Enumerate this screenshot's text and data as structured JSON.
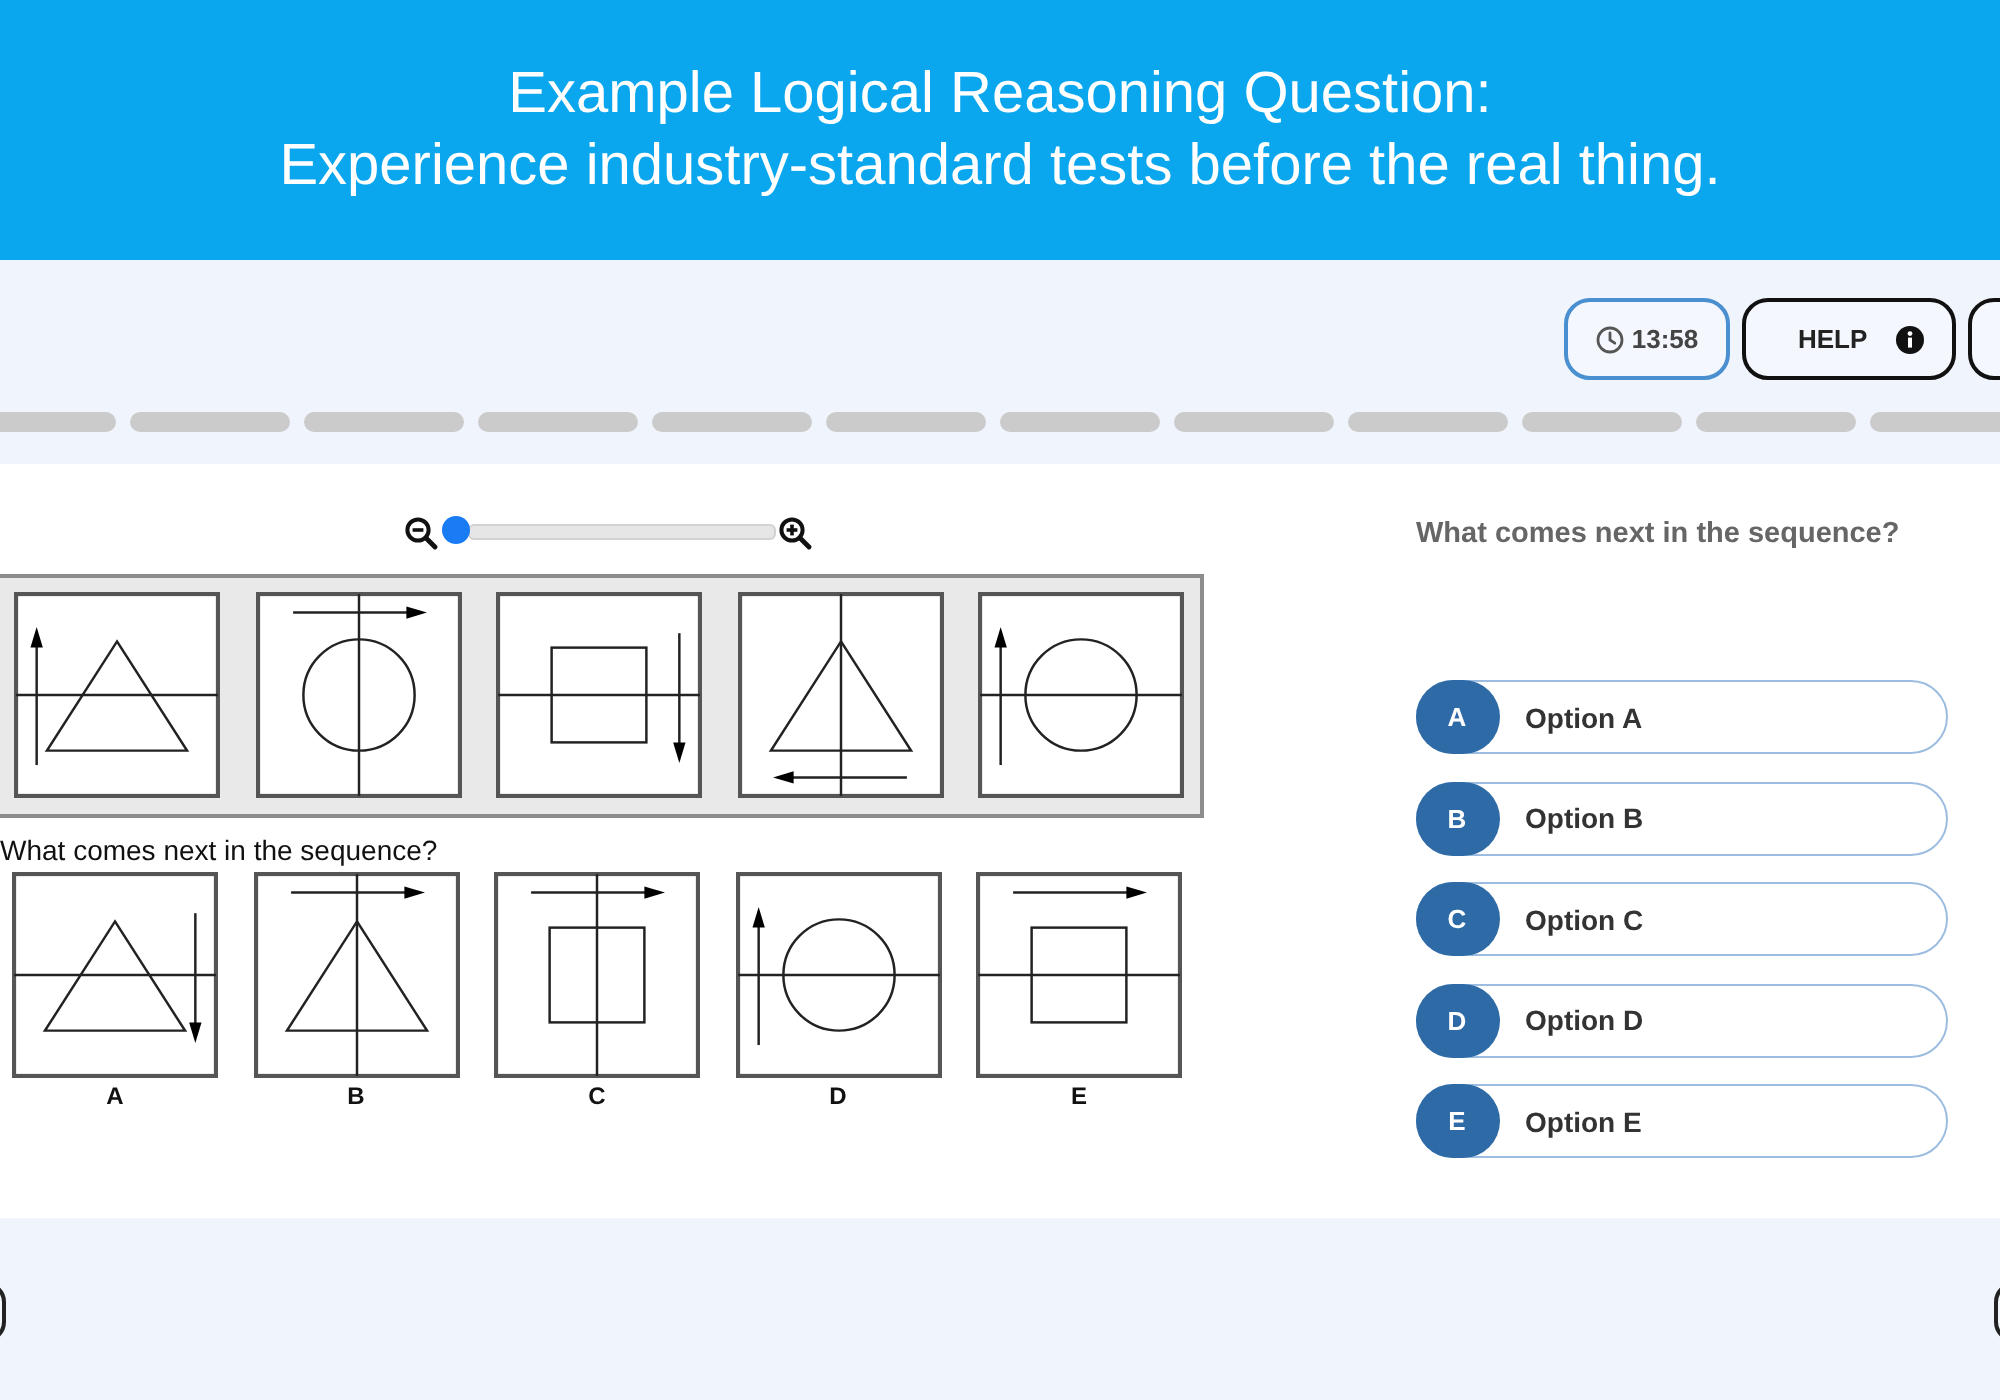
{
  "banner": {
    "title": "Example Logical Reasoning Question:",
    "subtitle": "Experience industry-standard tests before the real thing."
  },
  "toolbar": {
    "timer": "13:58",
    "help": "HELP"
  },
  "progress": {
    "segments": [
      {
        "completed": false
      },
      {
        "completed": false
      },
      {
        "completed": false
      },
      {
        "completed": false
      },
      {
        "completed": false
      },
      {
        "completed": false
      },
      {
        "completed": false
      },
      {
        "completed": false
      },
      {
        "completed": false
      },
      {
        "completed": false
      },
      {
        "completed": false
      },
      {
        "completed": false
      }
    ]
  },
  "zoom": {
    "level": 0
  },
  "puzzle": {
    "sequence": [
      {
        "elements": [
          {
            "kind": "triangle"
          },
          {
            "kind": "horizontal-line"
          },
          {
            "kind": "up-arrow"
          }
        ]
      },
      {
        "elements": [
          {
            "kind": "circle"
          },
          {
            "kind": "vertical-line"
          },
          {
            "kind": "right-arrow"
          }
        ]
      },
      {
        "elements": [
          {
            "kind": "square"
          },
          {
            "kind": "horizontal-line"
          },
          {
            "kind": "down-arrow"
          }
        ]
      },
      {
        "elements": [
          {
            "kind": "triangle"
          },
          {
            "kind": "vertical-line"
          },
          {
            "kind": "left-arrow"
          }
        ]
      },
      {
        "elements": [
          {
            "kind": "circle"
          },
          {
            "kind": "horizontal-line"
          },
          {
            "kind": "up-arrow"
          }
        ]
      }
    ],
    "prompt": "What comes next in the sequence?",
    "answers": [
      {
        "label": "A",
        "elements": [
          {
            "kind": "triangle"
          },
          {
            "kind": "horizontal-line"
          },
          {
            "kind": "down-arrow"
          }
        ]
      },
      {
        "label": "B",
        "elements": [
          {
            "kind": "triangle"
          },
          {
            "kind": "vertical-line"
          },
          {
            "kind": "right-arrow"
          }
        ]
      },
      {
        "label": "C",
        "elements": [
          {
            "kind": "square"
          },
          {
            "kind": "vertical-line"
          },
          {
            "kind": "right-arrow"
          }
        ]
      },
      {
        "label": "D",
        "elements": [
          {
            "kind": "circle"
          },
          {
            "kind": "horizontal-line"
          },
          {
            "kind": "up-arrow"
          }
        ]
      },
      {
        "label": "E",
        "elements": [
          {
            "kind": "square"
          },
          {
            "kind": "horizontal-line"
          },
          {
            "kind": "right-arrow"
          }
        ]
      }
    ]
  },
  "question": {
    "text": "What comes next in the sequence?",
    "options": [
      {
        "letter": "A",
        "label": "Option A",
        "selected": false
      },
      {
        "letter": "B",
        "label": "Option B",
        "selected": false
      },
      {
        "letter": "C",
        "label": "Option C",
        "selected": false
      },
      {
        "letter": "D",
        "label": "Option D",
        "selected": false
      },
      {
        "letter": "E",
        "label": "Option E",
        "selected": false
      }
    ]
  }
}
